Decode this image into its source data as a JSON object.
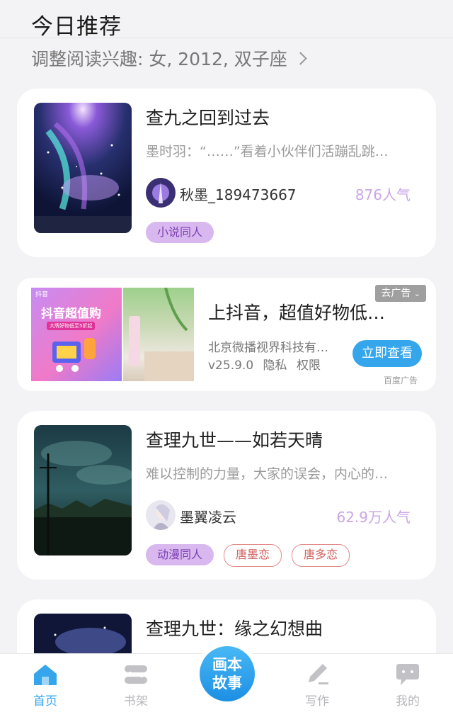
{
  "header": {
    "title": "今日推荐",
    "preferences": "调整阅读兴趣: 女, 2012, 双子座"
  },
  "books": [
    {
      "title": "查九之回到过去",
      "description": "墨时羽：“……”看着小伙伴们活蹦乱跳…",
      "author": "秋墨_189473667",
      "popularity": "876人气",
      "tags": [
        "小说同人"
      ]
    },
    {
      "title": "查理九世——如若天晴",
      "description": "难以控制的力量，大家的误会，内心的…",
      "author": "墨翼凌云",
      "popularity": "62.9万人气",
      "tags": [
        "动漫同人",
        "唐墨恋",
        "唐多恋"
      ]
    },
    {
      "title": "查理九世：缘之幻想曲"
    }
  ],
  "ad": {
    "title": "上抖音，超值好物低…",
    "company": "北京微播视界科技有…",
    "version": "v25.9.0",
    "privacy": "隐私",
    "permissions": "权限",
    "close_label": "去广告",
    "cta": "立即查看",
    "source": "百度广告",
    "image_text_1": "抖音",
    "image_text_2": "抖音超值购",
    "image_text_3": "大牌好物低至5折起"
  },
  "bottom_nav": {
    "items": [
      {
        "label": "首页",
        "icon": "home-icon",
        "active": true
      },
      {
        "label": "书架",
        "icon": "bookshelf-icon",
        "active": false
      },
      {
        "label": "写作",
        "icon": "pencil-icon",
        "active": false
      },
      {
        "label": "我的",
        "icon": "chat-bubble-icon",
        "active": false
      }
    ],
    "center_button": "画本故事"
  },
  "colors": {
    "accent_blue": "#36a6ec",
    "tag_purple_bg": "#d9b8f0",
    "popularity_text": "#caa6e6",
    "outline_tag": "#e38a88"
  }
}
